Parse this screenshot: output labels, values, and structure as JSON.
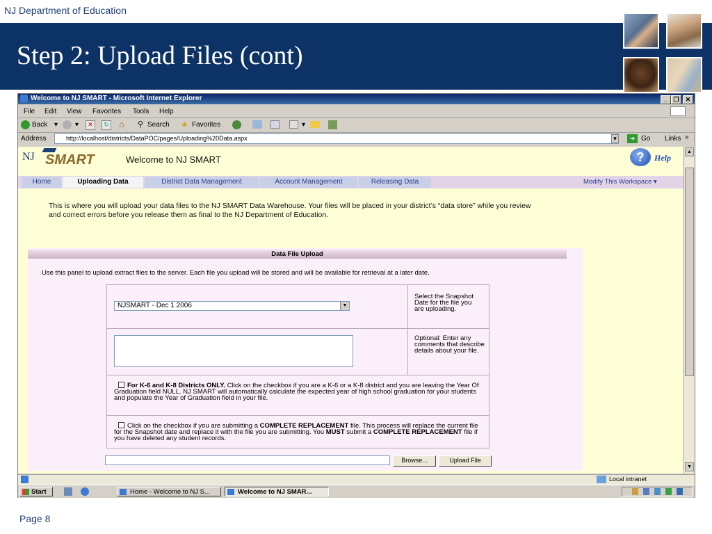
{
  "slide": {
    "department": "NJ Department of Education",
    "title": "Step 2:  Upload Files (cont)",
    "page": "Page 8"
  },
  "window": {
    "title": "Welcome to NJ SMART - Microsoft Internet Explorer"
  },
  "menu": [
    "File",
    "Edit",
    "View",
    "Favorites",
    "Tools",
    "Help"
  ],
  "toolbar": {
    "back": "Back",
    "search": "Search",
    "favorites": "Favorites"
  },
  "addressbar": {
    "label": "Address",
    "url": "http://localhost/districts/DataPOC/pages/Uploading%20Data.aspx",
    "go": "Go",
    "links": "Links"
  },
  "site": {
    "logo_nj": "NJ",
    "logo_smart": "SMART",
    "welcome": "Welcome to NJ SMART",
    "help": "Help",
    "tabs": [
      "Home",
      "Uploading Data",
      "District Data Management",
      "Account Management",
      "Releasing Data"
    ],
    "active_tab": "Uploading Data",
    "modify_workspace": "Modify This Workspace",
    "intro": "This is where you will upload your data files to the NJ SMART Data Warehouse. Your files will be placed in your district’s “data store” while you review and correct errors before you release them as final to the NJ Department of Education."
  },
  "panel": {
    "header": "Data File Upload",
    "description": "Use this panel to upload extract files to the server.  Each file you upload will be stored and will be available for retrieval at a later date.",
    "snapshot_value": "NJSMART - Dec 1 2006",
    "snapshot_help": "Select the Snapshot Date for the file you are uploading.",
    "comments_help": "Optional: Enter any comments that describe details about your file.",
    "k8_bold": "For K-6 and K-8 Districts ONLY.",
    "k8_text": " Click on the checkbox if you are a K-6 or a K-8 district and you are leaving the Year Of Graduation field NULL. NJ SMART will automatically calculate the expected year of high school graduation for your students and populate the Year of Graduation field in your file.",
    "replace_text1": "Click on the checkbox if you are submitting a ",
    "replace_bold1": "COMPLETE REPLACEMENT",
    "replace_text2": " file. This process will replace the current file for the Snapshot date and replace it with the file you are submitting. You ",
    "replace_bold2": "MUST",
    "replace_text3": " submit a ",
    "replace_bold3": "COMPLETE REPLACEMENT",
    "replace_text4": " file if you have deleted any student records.",
    "browse": "Browse...",
    "upload": "Upload File"
  },
  "statusbar": {
    "zone": "Local intranet"
  },
  "taskbar": {
    "start": "Start",
    "task1": "Home - Welcome to NJ S...",
    "task2": "Welcome to NJ SMAR..."
  }
}
